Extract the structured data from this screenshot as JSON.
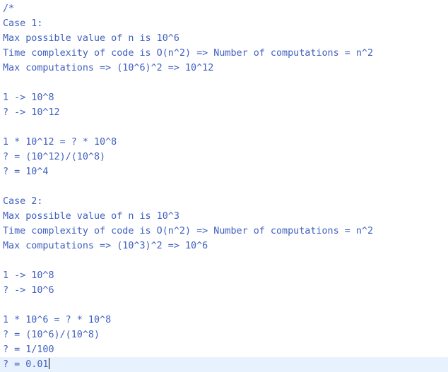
{
  "editor": {
    "lines": [
      "/*",
      "Case 1:",
      "Max possible value of n is 10^6",
      "Time complexity of code is O(n^2) => Number of computations = n^2",
      "Max computations => (10^6)^2 => 10^12",
      "",
      "1 -> 10^8",
      "? -> 10^12",
      "",
      "1 * 10^12 = ? * 10^8",
      "? = (10^12)/(10^8)",
      "? = 10^4",
      "",
      "Case 2:",
      "Max possible value of n is 10^3",
      "Time complexity of code is O(n^2) => Number of computations = n^2",
      "Max computations => (10^3)^2 => 10^6",
      "",
      "1 -> 10^8",
      "? -> 10^6",
      "",
      "1 * 10^6 = ? * 10^8",
      "? = (10^6)/(10^8)",
      "? = 1/100",
      "? = 0.01"
    ],
    "current_line_index": 24,
    "colors": {
      "comment_text": "#3f5fbf",
      "current_line_highlight": "#e8f2fe",
      "background": "#ffffff"
    }
  }
}
